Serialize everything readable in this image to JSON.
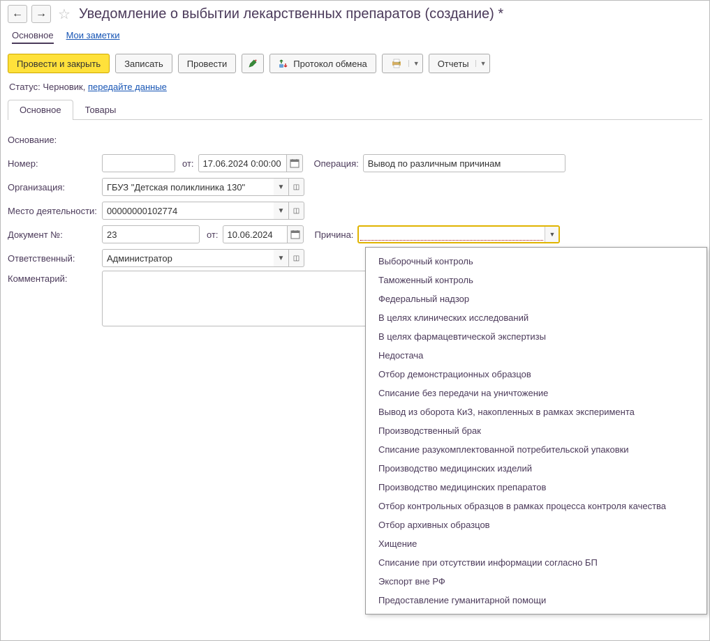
{
  "header": {
    "title": "Уведомление о выбытии лекарственных препаратов (создание) *"
  },
  "topTabs": {
    "main": "Основное",
    "notes": "Мои заметки"
  },
  "toolbar": {
    "postAndClose": "Провести и закрыть",
    "write": "Записать",
    "post": "Провести",
    "protocol": "Протокол обмена",
    "reports": "Отчеты"
  },
  "status": {
    "label": "Статус:",
    "value": "Черновик,",
    "link": "передайте данные"
  },
  "formTabs": {
    "main": "Основное",
    "goods": "Товары"
  },
  "form": {
    "basisLabel": "Основание:",
    "numberLabel": "Номер:",
    "numberValue": "",
    "fromLabel": "от:",
    "dateTime": "17.06.2024  0:00:00",
    "operationLabel": "Операция:",
    "operationValue": "Вывод по различным причинам",
    "orgLabel": "Организация:",
    "orgValue": "ГБУЗ \"Детская поликлиника 130\"",
    "placeLabel": "Место деятельности:",
    "placeValue": "00000000102774",
    "docNumLabel": "Документ №:",
    "docNumValue": "23",
    "docFromLabel": "от:",
    "docDate": "10.06.2024",
    "reasonLabel": "Причина:",
    "reasonValue": "",
    "responsibleLabel": "Ответственный:",
    "responsibleValue": "Администратор",
    "commentLabel": "Комментарий:",
    "commentValue": ""
  },
  "reasonOptions": [
    "Выборочный контроль",
    "Таможенный контроль",
    "Федеральный надзор",
    "В целях клинических исследований",
    "В целях фармацевтической экспертизы",
    "Недостача",
    "Отбор демонстрационных образцов",
    "Списание без передачи на уничтожение",
    "Вывод из оборота КиЗ, накопленных в рамках эксперимента",
    "Производственный брак",
    "Списание разукомплектованной потребительской упаковки",
    "Производство медицинских изделий",
    "Производство медицинских препаратов",
    "Отбор контрольных образцов в рамках процесса контроля качества",
    "Отбор архивных образцов",
    "Хищение",
    "Списание при отсутствии информации согласно БП",
    "Экспорт вне РФ",
    "Предоставление гуманитарной помощи"
  ]
}
